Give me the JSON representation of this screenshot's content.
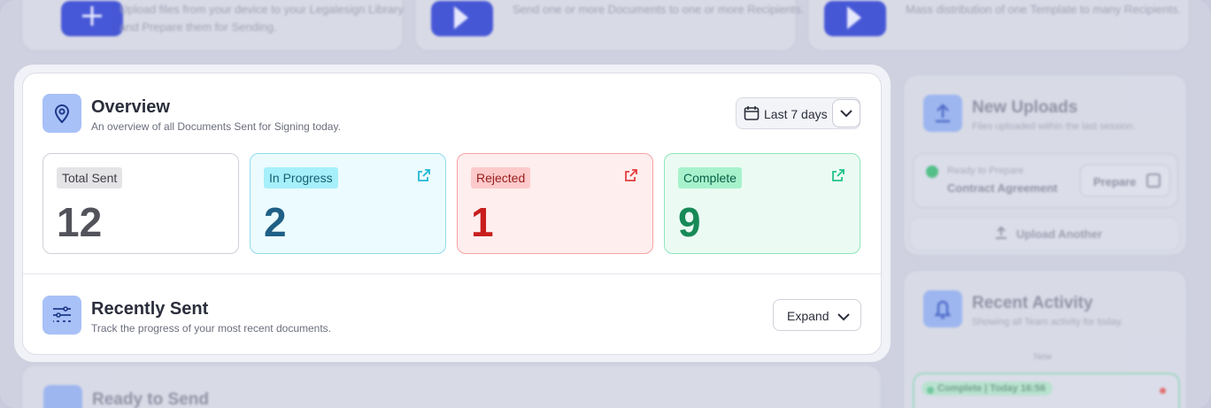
{
  "top_cards": [
    {
      "text": "Upload files from your device to your Legalesign Library and Prepare them for Sending."
    },
    {
      "text": "Send one or more Documents to one or more Recipients."
    },
    {
      "text": "Mass distribution of one Template to many Recipients."
    }
  ],
  "overview": {
    "title": "Overview",
    "subtitle": "An overview of all Documents Sent for Signing today.",
    "range_label": "Last 7 days",
    "stats": [
      {
        "label": "Total Sent",
        "value": "12"
      },
      {
        "label": "In Progress",
        "value": "2"
      },
      {
        "label": "Rejected",
        "value": "1"
      },
      {
        "label": "Complete",
        "value": "9"
      }
    ]
  },
  "recently_sent": {
    "title": "Recently Sent",
    "subtitle": "Track the progress of your most recent documents.",
    "expand_label": "Expand"
  },
  "ready_to_send": {
    "title": "Ready to Send"
  },
  "new_uploads": {
    "title": "New Uploads",
    "subtitle": "Files uploaded within the last session.",
    "item_status": "Ready to Prepare",
    "item_name": "Contract Agreement",
    "prepare_label": "Prepare",
    "upload_another_label": "Upload Another"
  },
  "recent_activity": {
    "title": "Recent Activity",
    "subtitle": "Showing all Team activity for today.",
    "divider_label": "New",
    "badge": "Complete | Today 16:56"
  },
  "colors": {
    "accent": "#3f51d6",
    "in_progress": "#1f5f86",
    "rejected": "#c81e1e",
    "complete": "#178a57"
  }
}
